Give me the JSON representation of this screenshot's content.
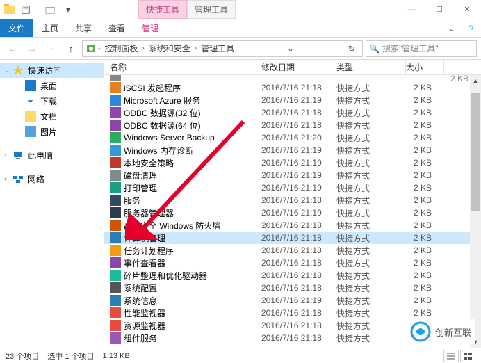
{
  "title_tabs": {
    "contextual1": "快捷工具",
    "contextual2": "管理工具"
  },
  "ribbon": {
    "file": "文件",
    "tabs": [
      "主页",
      "共享",
      "查看",
      "管理"
    ]
  },
  "breadcrumb": {
    "segs": [
      "控制面板",
      "系统和安全",
      "管理工具"
    ]
  },
  "search": {
    "placeholder": "搜索\"管理工具\""
  },
  "nav": {
    "quick": "快速访问",
    "desktop": "桌面",
    "downloads": "下载",
    "documents": "文档",
    "pictures": "图片",
    "thispc": "此电脑",
    "network": "网络"
  },
  "columns": {
    "name": "名称",
    "date": "修改日期",
    "type": "类型",
    "size": "大小"
  },
  "files": [
    {
      "name": "iSCSI 发起程序",
      "date": "2016/7/16 21:18",
      "type": "快捷方式",
      "size": "2 KB",
      "ico": "#e67e22"
    },
    {
      "name": "Microsoft Azure 服务",
      "date": "2016/7/16 21:19",
      "type": "快捷方式",
      "size": "2 KB",
      "ico": "#2e86de"
    },
    {
      "name": "ODBC 数据源(32 位)",
      "date": "2016/7/16 21:18",
      "type": "快捷方式",
      "size": "2 KB",
      "ico": "#8e44ad"
    },
    {
      "name": "ODBC 数据源(64 位)",
      "date": "2016/7/16 21:18",
      "type": "快捷方式",
      "size": "2 KB",
      "ico": "#8e44ad"
    },
    {
      "name": "Windows Server Backup",
      "date": "2016/7/16 21:20",
      "type": "快捷方式",
      "size": "2 KB",
      "ico": "#27ae60"
    },
    {
      "name": "Windows 内存诊断",
      "date": "2016/7/16 21:19",
      "type": "快捷方式",
      "size": "2 KB",
      "ico": "#3498db"
    },
    {
      "name": "本地安全策略",
      "date": "2016/7/16 21:19",
      "type": "快捷方式",
      "size": "2 KB",
      "ico": "#c0392b"
    },
    {
      "name": "磁盘清理",
      "date": "2016/7/16 21:19",
      "type": "快捷方式",
      "size": "2 KB",
      "ico": "#7f8c8d"
    },
    {
      "name": "打印管理",
      "date": "2016/7/16 21:19",
      "type": "快捷方式",
      "size": "2 KB",
      "ico": "#16a085"
    },
    {
      "name": "服务",
      "date": "2016/7/16 21:18",
      "type": "快捷方式",
      "size": "2 KB",
      "ico": "#34495e"
    },
    {
      "name": "服务器管理器",
      "date": "2016/7/16 21:19",
      "type": "快捷方式",
      "size": "2 KB",
      "ico": "#2c3e50"
    },
    {
      "name": "高级安全 Windows 防火墙",
      "date": "2016/7/16 21:18",
      "type": "快捷方式",
      "size": "2 KB",
      "ico": "#d35400"
    },
    {
      "name": "计算机管理",
      "date": "2016/7/16 21:18",
      "type": "快捷方式",
      "size": "2 KB",
      "ico": "#2980b9",
      "selected": true
    },
    {
      "name": "任务计划程序",
      "date": "2016/7/16 21:18",
      "type": "快捷方式",
      "size": "2 KB",
      "ico": "#f39c12"
    },
    {
      "name": "事件查看器",
      "date": "2016/7/16 21:18",
      "type": "快捷方式",
      "size": "2 KB",
      "ico": "#8e44ad"
    },
    {
      "name": "碎片整理和优化驱动器",
      "date": "2016/7/16 21:18",
      "type": "快捷方式",
      "size": "2 KB",
      "ico": "#1abc9c"
    },
    {
      "name": "系统配置",
      "date": "2016/7/16 21:18",
      "type": "快捷方式",
      "size": "2 KB",
      "ico": "#555"
    },
    {
      "name": "系统信息",
      "date": "2016/7/16 21:19",
      "type": "快捷方式",
      "size": "2 KB",
      "ico": "#2980b9"
    },
    {
      "name": "性能监视器",
      "date": "2016/7/16 21:18",
      "type": "快捷方式",
      "size": "2 KB",
      "ico": "#e74c3c"
    },
    {
      "name": "资源监视器",
      "date": "2016/7/16 21:18",
      "type": "快捷方式",
      "size": "2 KB",
      "ico": "#e74c3c"
    },
    {
      "name": "组件服务",
      "date": "2016/7/16 21:18",
      "type": "快捷方式",
      "size": "2 KB",
      "ico": "#9b59b6"
    }
  ],
  "status": {
    "count": "23 个项目",
    "selection": "选中 1 个项目",
    "size": "1.13 KB"
  },
  "watermark": "创新互联"
}
